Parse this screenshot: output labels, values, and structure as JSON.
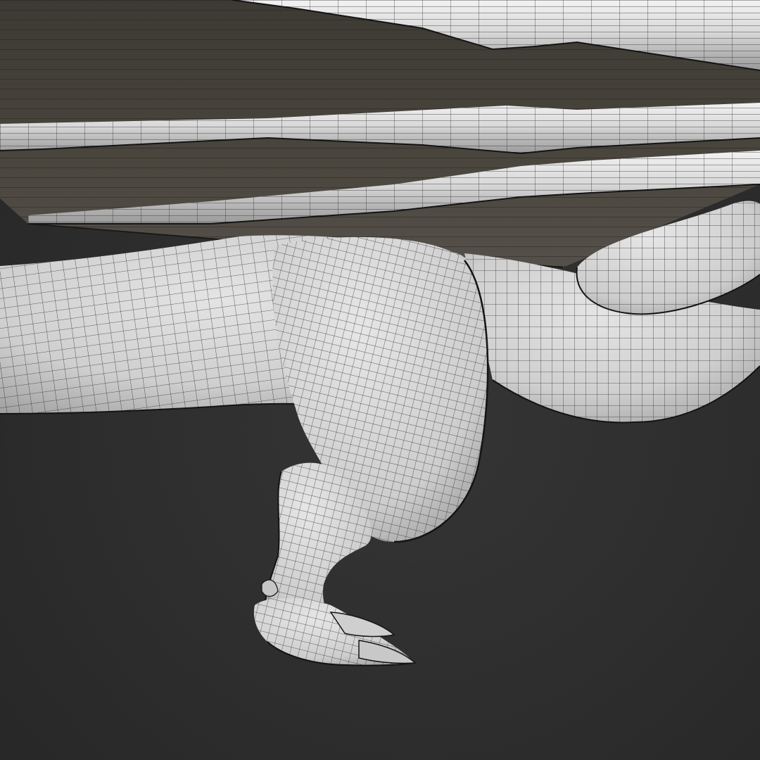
{
  "viewport": {
    "background_color": "#2b2b2b",
    "model_color": "#d6d6d6",
    "wing_membrane_color": "#46423b",
    "wireframe_color": "#1a1a1a",
    "overlay": "wireframe"
  }
}
